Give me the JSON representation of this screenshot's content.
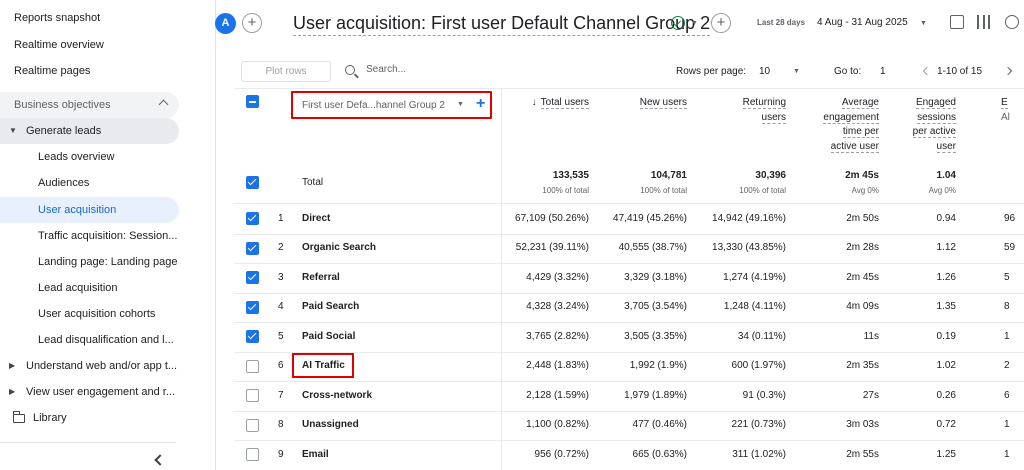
{
  "sidebar": {
    "items": [
      {
        "label": "Reports snapshot"
      },
      {
        "label": "Realtime overview"
      },
      {
        "label": "Realtime pages"
      },
      {
        "label": "Business objectives"
      },
      {
        "label": "Generate leads"
      },
      {
        "label": "Leads overview"
      },
      {
        "label": "Audiences"
      },
      {
        "label": "User acquisition"
      },
      {
        "label": "Traffic acquisition: Session..."
      },
      {
        "label": "Landing page: Landing page"
      },
      {
        "label": "Lead acquisition"
      },
      {
        "label": "User acquisition cohorts"
      },
      {
        "label": "Lead disqualification and l..."
      },
      {
        "label": "Understand web and/or app t..."
      },
      {
        "label": "View user engagement and r..."
      },
      {
        "label": "Library"
      }
    ]
  },
  "header": {
    "avatar_letter": "A",
    "plus_symbol": "+",
    "title": "User acquisition: First user Default Channel Group 2",
    "date_label": "Last 28 days",
    "date_range": "4 Aug - 31 Aug 2025",
    "caret": "▼"
  },
  "toolbar": {
    "plot_rows": "Plot rows",
    "search_placeholder": "Search...",
    "rows_per_page_label": "Rows per page:",
    "rows_per_page_value": "10",
    "goto_label": "Go to:",
    "goto_value": "1",
    "range": "1-10 of 15"
  },
  "table": {
    "dimension_label": "First user Defa...hannel Group 2",
    "dimension_plus": "+",
    "sort_arrow": "↓",
    "columns": [
      {
        "lines": [
          "Total users"
        ]
      },
      {
        "lines": [
          "New users"
        ]
      },
      {
        "lines": [
          "Returning",
          "users"
        ]
      },
      {
        "lines": [
          "Average",
          "engagement",
          "time per",
          "active user"
        ]
      },
      {
        "lines": [
          "Engaged",
          "sessions",
          "per active",
          "user"
        ]
      },
      {
        "lines": [
          "E",
          "Al"
        ]
      }
    ],
    "total": {
      "label": "Total",
      "values": [
        "133,535",
        "104,781",
        "30,396",
        "2m 45s",
        "1.04"
      ],
      "subs": [
        "100% of total",
        "100% of total",
        "100% of total",
        "Avg 0%",
        "Avg 0%"
      ]
    },
    "rows": [
      {
        "num": "1",
        "name": "Direct",
        "checked": true,
        "values": [
          "67,109 (50.26%)",
          "47,419 (45.26%)",
          "14,942 (49.16%)",
          "2m 50s",
          "0.94",
          "96"
        ]
      },
      {
        "num": "2",
        "name": "Organic Search",
        "checked": true,
        "values": [
          "52,231 (39.11%)",
          "40,555 (38.7%)",
          "13,330 (43.85%)",
          "2m 28s",
          "1.12",
          "59"
        ]
      },
      {
        "num": "3",
        "name": "Referral",
        "checked": true,
        "values": [
          "4,429 (3.32%)",
          "3,329 (3.18%)",
          "1,274 (4.19%)",
          "2m 45s",
          "1.26",
          "5"
        ]
      },
      {
        "num": "4",
        "name": "Paid Search",
        "checked": true,
        "values": [
          "4,328 (3.24%)",
          "3,705 (3.54%)",
          "1,248 (4.11%)",
          "4m 09s",
          "1.35",
          "8"
        ]
      },
      {
        "num": "5",
        "name": "Paid Social",
        "checked": true,
        "values": [
          "3,765 (2.82%)",
          "3,505 (3.35%)",
          "34 (0.11%)",
          "11s",
          "0.19",
          "1"
        ]
      },
      {
        "num": "6",
        "name": "AI Traffic",
        "checked": false,
        "values": [
          "2,448 (1.83%)",
          "1,992 (1.9%)",
          "600 (1.97%)",
          "2m 35s",
          "1.02",
          "2"
        ]
      },
      {
        "num": "7",
        "name": "Cross-network",
        "checked": false,
        "values": [
          "2,128 (1.59%)",
          "1,979 (1.89%)",
          "91 (0.3%)",
          "27s",
          "0.26",
          "6"
        ]
      },
      {
        "num": "8",
        "name": "Unassigned",
        "checked": false,
        "values": [
          "1,100 (0.82%)",
          "477 (0.46%)",
          "221 (0.73%)",
          "3m 03s",
          "0.72",
          "1"
        ]
      },
      {
        "num": "9",
        "name": "Email",
        "checked": false,
        "values": [
          "956 (0.72%)",
          "665 (0.63%)",
          "311 (1.02%)",
          "2m 55s",
          "1.25",
          "1"
        ]
      }
    ]
  }
}
